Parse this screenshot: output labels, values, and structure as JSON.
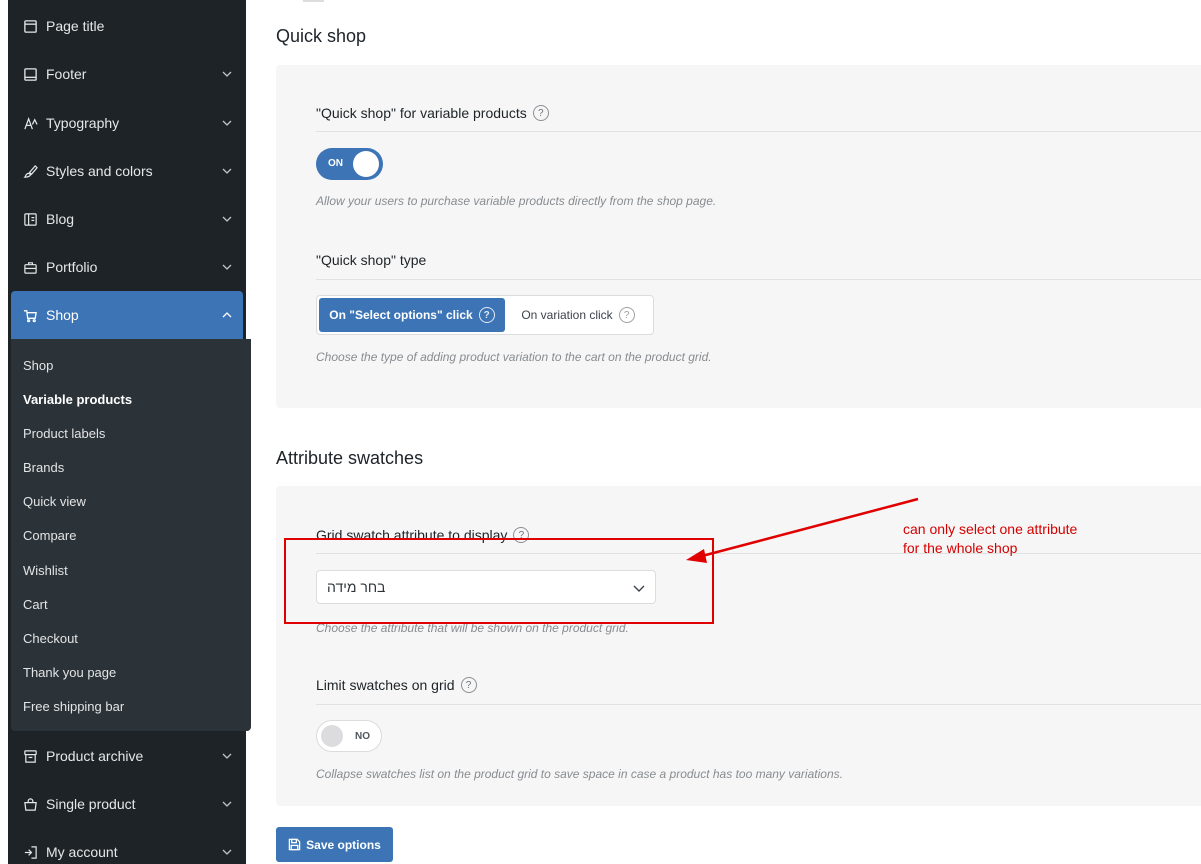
{
  "sidebar": {
    "items": [
      {
        "label": "Page title",
        "icon": "page-title-icon"
      },
      {
        "label": "Footer",
        "icon": "footer-icon"
      },
      {
        "label": "Typography",
        "icon": "typography-icon"
      },
      {
        "label": "Styles and colors",
        "icon": "brush-icon"
      },
      {
        "label": "Blog",
        "icon": "blog-icon"
      },
      {
        "label": "Portfolio",
        "icon": "briefcase-icon"
      },
      {
        "label": "Shop",
        "icon": "cart-icon"
      },
      {
        "label": "Product archive",
        "icon": "archive-icon"
      },
      {
        "label": "Single product",
        "icon": "bag-icon"
      },
      {
        "label": "My account",
        "icon": "login-icon"
      }
    ],
    "shop_submenu": [
      "Shop",
      "Variable products",
      "Product labels",
      "Brands",
      "Quick view",
      "Compare",
      "Wishlist",
      "Cart",
      "Checkout",
      "Thank you page",
      "Free shipping bar"
    ],
    "current_submenu": "Variable products"
  },
  "quick_shop": {
    "title": "Quick shop",
    "variable_label": "\"Quick shop\" for variable products",
    "variable_toggle": "ON",
    "variable_help": "Allow your users to purchase variable products directly from the shop page.",
    "type_label": "\"Quick shop\" type",
    "type_options": [
      "On \"Select options\" click",
      "On variation click"
    ],
    "type_selected": "On \"Select options\" click",
    "type_help": "Choose the type of adding product variation to the cart on the product grid."
  },
  "attribute_swatches": {
    "title": "Attribute swatches",
    "grid_label": "Grid swatch attribute to display",
    "grid_value": "בחר מידה",
    "grid_help": "Choose the attribute that will be shown on the product grid.",
    "limit_label": "Limit swatches on grid",
    "limit_toggle": "NO",
    "limit_help": "Collapse swatches list on the product grid to save space in case a product has too many variations."
  },
  "save_label": "Save options",
  "annotation": {
    "line1": "can only select one attribute",
    "line2": "for the whole shop",
    "color": "#e10000"
  },
  "colors": {
    "sidebar_bg": "#1d2327",
    "accent": "#3c74b5",
    "panel_bg": "#f6f6f6"
  }
}
